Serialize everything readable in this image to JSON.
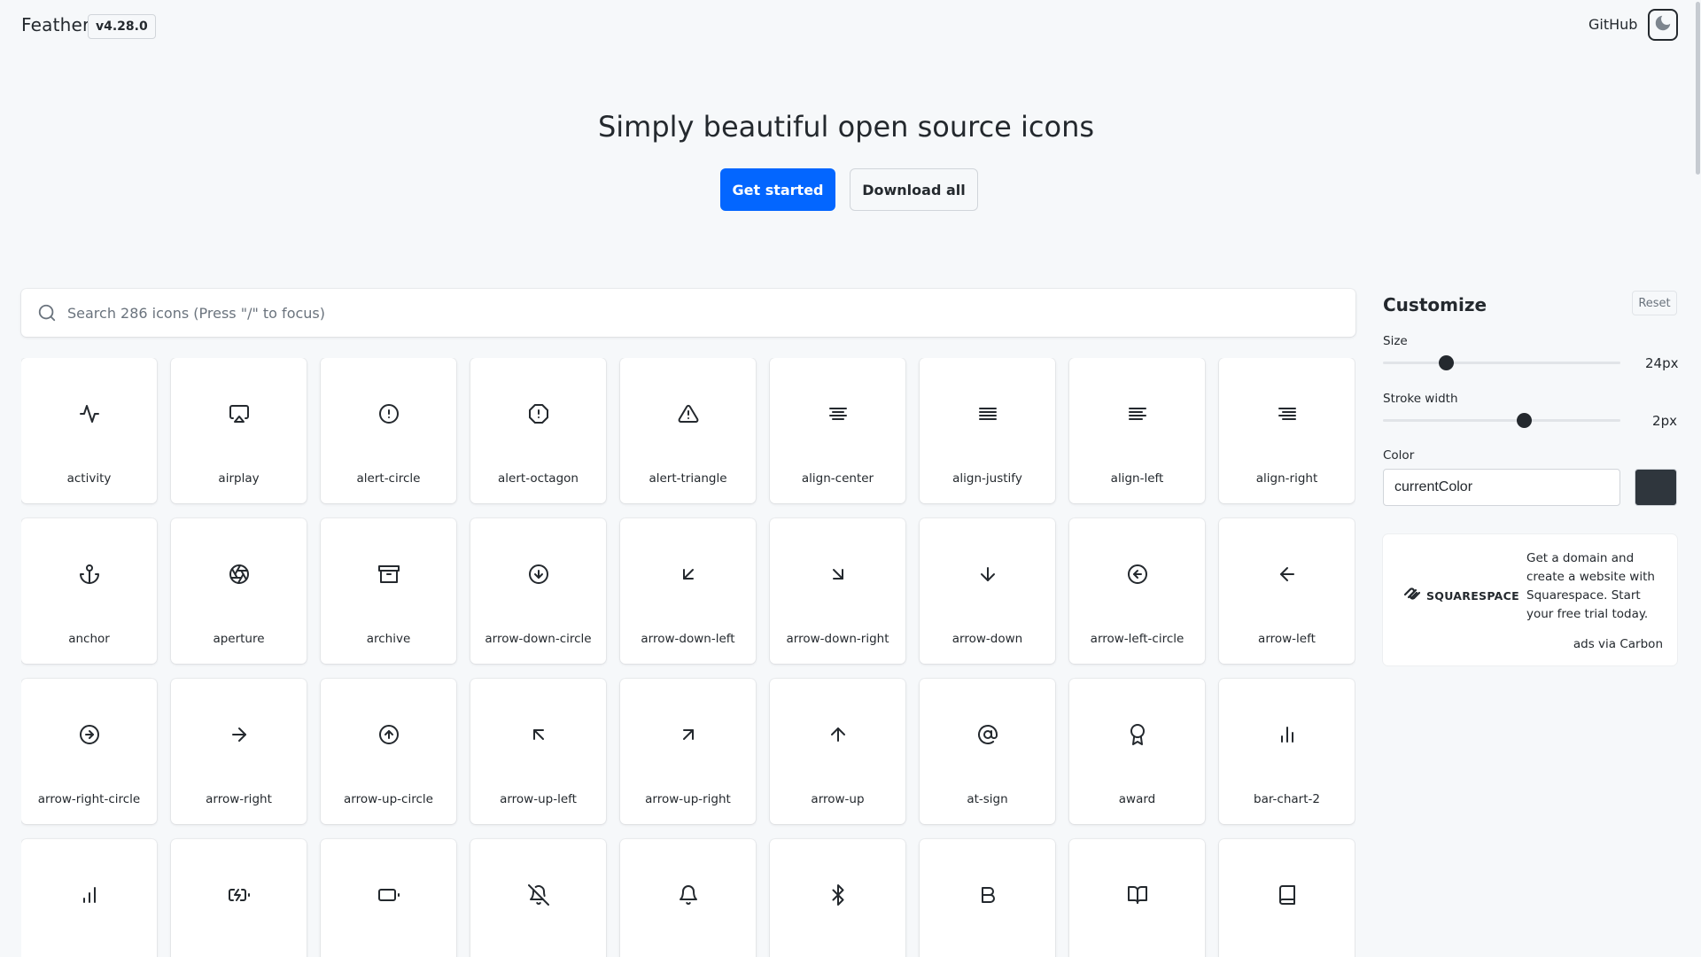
{
  "header": {
    "brand": "Feather",
    "version": "v4.28.0",
    "github_label": "GitHub",
    "theme_icon": "moon-icon"
  },
  "hero": {
    "title": "Simply beautiful open source icons",
    "primary_button": "Get started",
    "secondary_button": "Download all"
  },
  "search": {
    "placeholder": "Search 286 icons (Press \"/\" to focus)",
    "value": "",
    "icon": "search-icon"
  },
  "icons": [
    {
      "name": "activity"
    },
    {
      "name": "airplay"
    },
    {
      "name": "alert-circle"
    },
    {
      "name": "alert-octagon"
    },
    {
      "name": "alert-triangle"
    },
    {
      "name": "align-center"
    },
    {
      "name": "align-justify"
    },
    {
      "name": "align-left"
    },
    {
      "name": "align-right"
    },
    {
      "name": "anchor"
    },
    {
      "name": "aperture"
    },
    {
      "name": "archive"
    },
    {
      "name": "arrow-down-circle"
    },
    {
      "name": "arrow-down-left"
    },
    {
      "name": "arrow-down-right"
    },
    {
      "name": "arrow-down"
    },
    {
      "name": "arrow-left-circle"
    },
    {
      "name": "arrow-left"
    },
    {
      "name": "arrow-right-circle"
    },
    {
      "name": "arrow-right"
    },
    {
      "name": "arrow-up-circle"
    },
    {
      "name": "arrow-up-left"
    },
    {
      "name": "arrow-up-right"
    },
    {
      "name": "arrow-up"
    },
    {
      "name": "at-sign"
    },
    {
      "name": "award"
    },
    {
      "name": "bar-chart-2"
    },
    {
      "name": "bar-chart",
      "label_hidden": true
    },
    {
      "name": "battery-charging",
      "label_hidden": true
    },
    {
      "name": "battery",
      "label_hidden": true
    },
    {
      "name": "bell-off",
      "label_hidden": true
    },
    {
      "name": "bell",
      "label_hidden": true
    },
    {
      "name": "bluetooth",
      "label_hidden": true
    },
    {
      "name": "bold",
      "label_hidden": true
    },
    {
      "name": "book-open",
      "label_hidden": true
    },
    {
      "name": "book",
      "label_hidden": true
    }
  ],
  "customize": {
    "title": "Customize",
    "reset_label": "Reset",
    "size": {
      "label": "Size",
      "value": 24,
      "display": "24px",
      "min": 16,
      "max": 48
    },
    "stroke": {
      "label": "Stroke width",
      "value": 2,
      "display": "2px",
      "min": 0.5,
      "max": 3
    },
    "color": {
      "label": "Color",
      "value": "currentColor",
      "swatch": "#2f363d"
    }
  },
  "ad": {
    "logo_text": "SQUARESPACE",
    "copy": "Get a domain and create a website with Squarespace. Start your free trial today.",
    "via": "ads via Carbon"
  },
  "colors": {
    "accent": "#0366ff",
    "background": "#f6f8fa",
    "text": "#24292e"
  }
}
